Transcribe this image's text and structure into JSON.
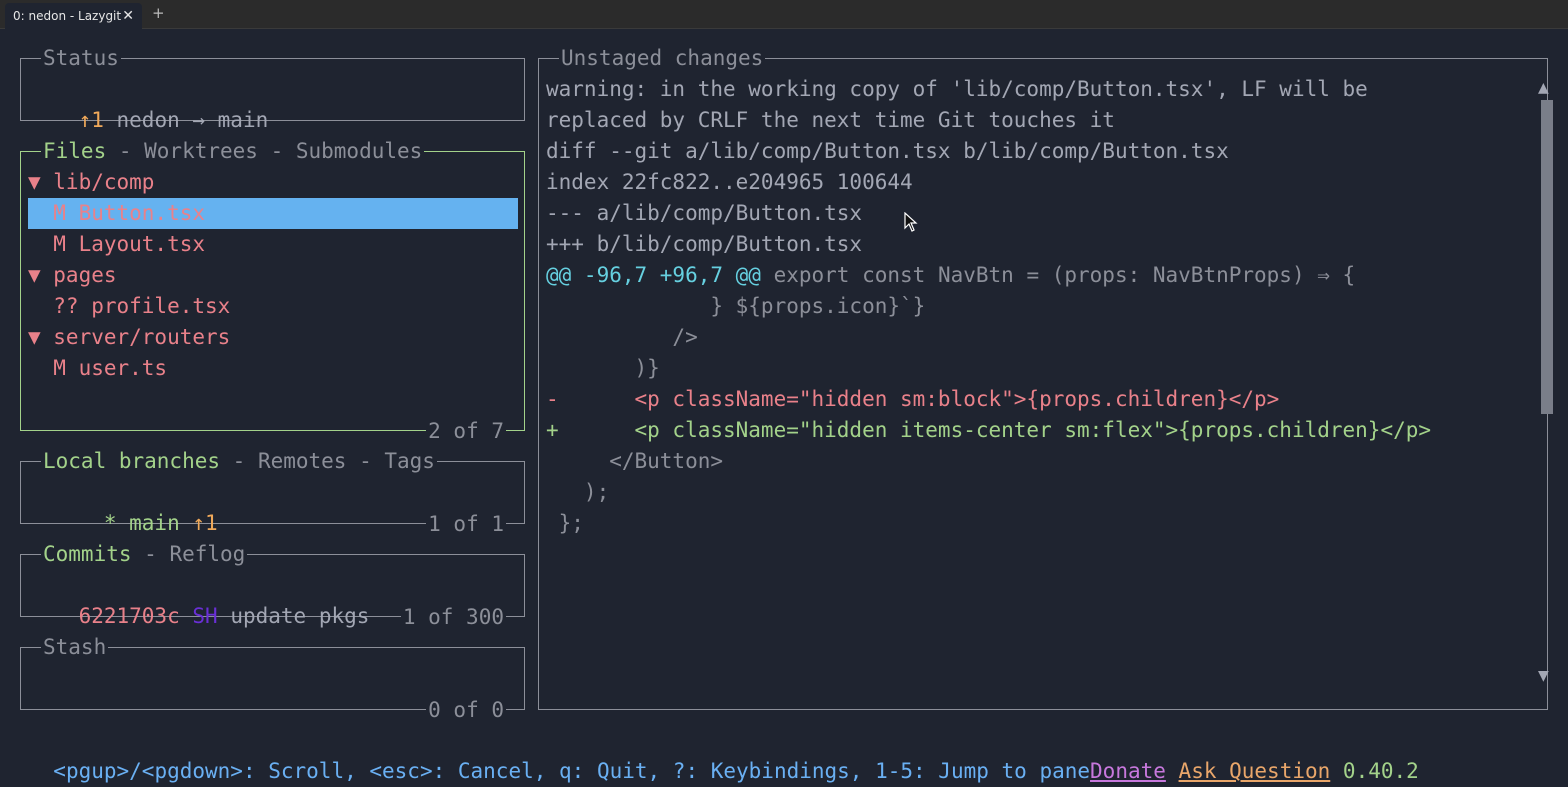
{
  "window": {
    "tab_title": "0: nedon - Lazygit",
    "tab_close_glyph": "✕",
    "tab_add_glyph": "+"
  },
  "status_pane": {
    "title": "Status",
    "ahead": "↑1",
    "repo_branch": " nedon → main"
  },
  "files_pane": {
    "title_active": "Files",
    "title_rest": " - Worktrees - Submodules",
    "footer": "2 of 7",
    "rows": [
      {
        "text": "▼ lib/comp",
        "kind": "dir"
      },
      {
        "text": "  M Button.tsx",
        "kind": "modified",
        "selected": true
      },
      {
        "text": "  M Layout.tsx",
        "kind": "modified"
      },
      {
        "text": "▼ pages",
        "kind": "dir"
      },
      {
        "text": "  ?? profile.tsx",
        "kind": "untracked"
      },
      {
        "text": "▼ server/routers",
        "kind": "dir"
      },
      {
        "text": "  M user.ts",
        "kind": "modified"
      }
    ]
  },
  "branches_pane": {
    "title_active": "Local branches",
    "title_rest": " - Remotes - Tags",
    "footer": "1 of 1",
    "row_star": "  * main ",
    "row_ahead": "↑1"
  },
  "commits_pane": {
    "title_active": "Commits",
    "title_rest": " - Reflog",
    "footer": "1 of 300",
    "hash": "6221703c",
    "author": "SH",
    "message": "update pkgs"
  },
  "stash_pane": {
    "title": "Stash",
    "footer": "0 of 0"
  },
  "diff_pane": {
    "title": "Unstaged changes",
    "lines": [
      {
        "text": "warning: in the working copy of 'lib/comp/Button.tsx', LF will be",
        "kind": "meta"
      },
      {
        "text": "replaced by CRLF the next time Git touches it",
        "kind": "meta"
      },
      {
        "text": "diff --git a/lib/comp/Button.tsx b/lib/comp/Button.tsx",
        "kind": "header"
      },
      {
        "text": "index 22fc822..e204965 100644",
        "kind": "header"
      },
      {
        "text": "--- a/lib/comp/Button.tsx",
        "kind": "header"
      },
      {
        "text": "+++ b/lib/comp/Button.tsx",
        "kind": "header"
      },
      {
        "hunk": "@@ -96,7 +96,7 @@",
        "text": " export const NavBtn = (props: NavBtnProps) ⇒ {",
        "kind": "hunk"
      },
      {
        "text": "             } ${props.icon}`}",
        "kind": "context"
      },
      {
        "text": "          />",
        "kind": "context"
      },
      {
        "text": "       )}",
        "kind": "context"
      },
      {
        "text": "-      <p className=\"hidden sm:block\">{props.children}</p>",
        "kind": "removed"
      },
      {
        "text": "+      <p className=\"hidden items-center sm:flex\">{props.children}</p>",
        "kind": "added"
      },
      {
        "text": "     </Button>",
        "kind": "context"
      },
      {
        "text": "   );",
        "kind": "context"
      },
      {
        "text": " };",
        "kind": "context"
      }
    ]
  },
  "statusbar": {
    "keys": "<pgup>/<pgdown>: Scroll, <esc>: Cancel, q: Quit, ?: Keybindings, 1-5: Jump to pane",
    "donate": "Donate",
    "ask": "Ask Question",
    "version": "0.40.2"
  },
  "colors": {
    "background": "#1f2430",
    "active_border": "#a3d28a",
    "inactive_border": "#8c8f99",
    "selection": "#65b2f0",
    "removed": "#e9818a",
    "added": "#a3d28a",
    "hunk": "#66d0e0",
    "author": "#6a2fd6"
  },
  "icons": {
    "scroll_up": "▲",
    "scroll_down": "▼"
  }
}
